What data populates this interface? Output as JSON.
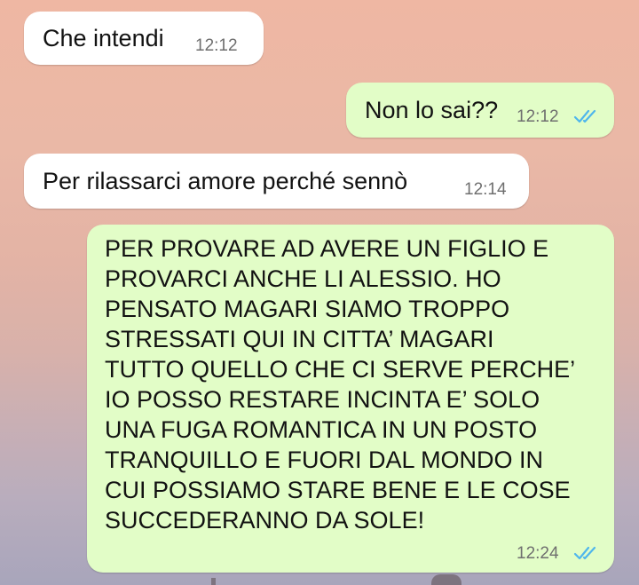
{
  "conversation": {
    "messages": [
      {
        "direction": "incoming",
        "text": "Che intendi",
        "time": "12:12"
      },
      {
        "direction": "outgoing",
        "text": "Non lo sai??",
        "time": "12:12",
        "status": "read"
      },
      {
        "direction": "incoming",
        "text": "Per rilassarci amore perché sennò",
        "time": "12:14"
      },
      {
        "direction": "outgoing",
        "lines": [
          "PER PROVARE AD AVERE UN FIGLIO E",
          "PROVARCI ANCHE LI ALESSIO. HO",
          "PENSATO MAGARI SIAMO TROPPO",
          "STRESSATI QUI IN CITTA’ MAGARI",
          "TUTTO QUELLO CHE CI SERVE PERCHE’",
          "IO POSSO RESTARE INCINTA E’ SOLO",
          "UNA FUGA ROMANTICA IN UN POSTO",
          "TRANQUILLO E FUORI DAL MONDO IN",
          "CUI POSSIAMO STARE BENE E LE COSE",
          "SUCCEDERANNO DA SOLE!"
        ],
        "time": "12:24",
        "status": "read"
      }
    ]
  },
  "colors": {
    "incoming_bubble": "#ffffff",
    "outgoing_bubble": "#e2fdc7",
    "read_ticks": "#4fb6ec",
    "timestamp": "#6f6f6f"
  },
  "icons": {
    "read_receipt": "double-check-icon"
  }
}
